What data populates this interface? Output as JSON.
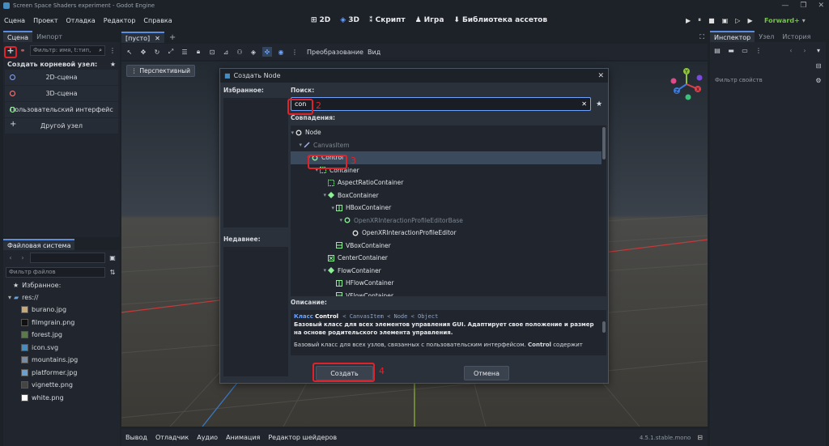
{
  "window": {
    "title": "Screen Space Shaders experiment - Godot Engine",
    "controls": [
      "—",
      "❐",
      "✕"
    ]
  },
  "menu": [
    "Сцена",
    "Проект",
    "Отладка",
    "Редактор",
    "Справка"
  ],
  "workspaces": [
    {
      "icon": "⊞",
      "label": "2D"
    },
    {
      "icon": "◈",
      "label": "3D"
    },
    {
      "icon": "⁑",
      "label": "Скрипт"
    },
    {
      "icon": "♟",
      "label": "Игра"
    },
    {
      "icon": "⬇",
      "label": "Библиотека ассетов"
    }
  ],
  "run_controls": [
    "▶",
    "⏸",
    "■",
    "▣",
    "▷",
    "▶"
  ],
  "renderer": "Forward+",
  "scene_dock": {
    "tabs": [
      "Сцена",
      "Импорт"
    ],
    "filter_placeholder": "Фильтр: имя, t:тип,",
    "create_root_label": "Создать корневой узел:",
    "root_options": [
      {
        "label": "2D-сцена",
        "color": "#8da5f3"
      },
      {
        "label": "3D-сцена",
        "color": "#fc7f7f"
      },
      {
        "label": "Пользовательский интерфейс",
        "color": "#8eef97"
      },
      {
        "label": "Другой узел",
        "color": "#e0e0e0"
      }
    ]
  },
  "filesystem_dock": {
    "title": "Файловая система",
    "filter_placeholder": "Фильтр файлов",
    "favorites": "Избранное:",
    "root": "res://",
    "files": [
      {
        "name": "burano.jpg",
        "color": "#c9a777"
      },
      {
        "name": "filmgrain.png",
        "color": "#111111"
      },
      {
        "name": "forest.jpg",
        "color": "#5a7a4a"
      },
      {
        "name": "icon.svg",
        "color": "#478cbf"
      },
      {
        "name": "mountains.jpg",
        "color": "#7a8aa0"
      },
      {
        "name": "platformer.jpg",
        "color": "#6aa0d0"
      },
      {
        "name": "vignette.png",
        "color": "#444444"
      },
      {
        "name": "white.png",
        "color": "#ffffff"
      }
    ]
  },
  "editor_tabs": {
    "scene_tab": "[пусто]",
    "close": "✕",
    "add": "+"
  },
  "toolbar": {
    "transform": "Преобразование",
    "view": "Вид"
  },
  "viewport": {
    "perspective": "Перспективный",
    "gizmo": [
      "Y",
      "X",
      "Z"
    ]
  },
  "inspector": {
    "tabs": [
      "Инспектор",
      "Узел",
      "История"
    ],
    "filter_placeholder": "Фильтр свойств"
  },
  "bottom_panel": {
    "items": [
      "Вывод",
      "Отладчик",
      "Аудио",
      "Анимация",
      "Редактор шейдеров"
    ],
    "version": "4.5.1.stable.mono"
  },
  "dialog": {
    "title": "Создать Node",
    "favorites": "Избранное:",
    "recent": "Недавнее:",
    "search_label": "Поиск:",
    "search_value": "con",
    "matches_label": "Совпадения:",
    "tree": [
      {
        "label": "Node",
        "depth": 0,
        "icon": "circle",
        "color": "#e0e0e0",
        "dim": false,
        "selected": false
      },
      {
        "label": "CanvasItem",
        "depth": 1,
        "icon": "pencil",
        "color": "#a5b7f3",
        "dim": true,
        "selected": false
      },
      {
        "label": "Control",
        "depth": 2,
        "icon": "circle",
        "color": "#8eef97",
        "dim": false,
        "selected": true
      },
      {
        "label": "Container",
        "depth": 3,
        "icon": "square-dashed",
        "color": "#8eef97",
        "dim": false,
        "selected": false
      },
      {
        "label": "AspectRatioContainer",
        "depth": 4,
        "icon": "square-dashed",
        "color": "#8eef97",
        "dim": false,
        "selected": false
      },
      {
        "label": "BoxContainer",
        "depth": 4,
        "icon": "diamond",
        "color": "#8eef97",
        "dim": false,
        "selected": false
      },
      {
        "label": "HBoxContainer",
        "depth": 5,
        "icon": "hbox",
        "color": "#8eef97",
        "dim": false,
        "selected": false
      },
      {
        "label": "OpenXRInteractionProfileEditorBase",
        "depth": 6,
        "icon": "circle",
        "color": "#8eef97",
        "dim": true,
        "selected": false
      },
      {
        "label": "OpenXRInteractionProfileEditor",
        "depth": 7,
        "icon": "circle",
        "color": "#e0e0e0",
        "dim": false,
        "selected": false
      },
      {
        "label": "VBoxContainer",
        "depth": 5,
        "icon": "vbox",
        "color": "#8eef97",
        "dim": false,
        "selected": false
      },
      {
        "label": "CenterContainer",
        "depth": 4,
        "icon": "center",
        "color": "#8eef97",
        "dim": false,
        "selected": false
      },
      {
        "label": "FlowContainer",
        "depth": 4,
        "icon": "diamond",
        "color": "#8eef97",
        "dim": false,
        "selected": false
      },
      {
        "label": "HFlowContainer",
        "depth": 5,
        "icon": "hbox",
        "color": "#8eef97",
        "dim": false,
        "selected": false
      },
      {
        "label": "VFlowContainer",
        "depth": 5,
        "icon": "vbox",
        "color": "#8eef97",
        "dim": false,
        "selected": false
      }
    ],
    "description_label": "Описание:",
    "desc_class_word": "Класс",
    "desc_class_name": "Control",
    "desc_inherits": "< CanvasItem < Node < Object",
    "desc_bold": "Базовый класс для всех элементов управления GUI. Адаптирует свое положение и размер на основе родительского элемента управления.",
    "desc_text_before": "Базовый класс для всех узлов, связанных с пользовательским интерфейсом.",
    "desc_text_bold": "Control",
    "desc_text_after": "содержит",
    "create_button": "Создать",
    "cancel_button": "Отмена"
  },
  "annotations": [
    "2",
    "3",
    "4"
  ]
}
